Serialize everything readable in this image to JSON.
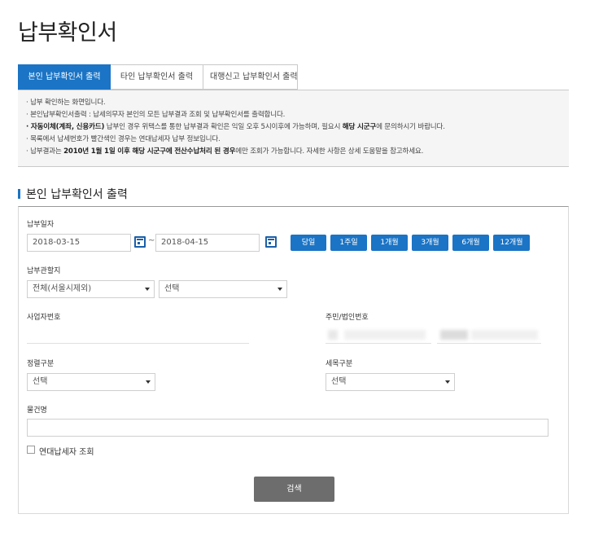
{
  "page": {
    "title": "납부확인서"
  },
  "tabs": [
    {
      "label": "본인 납부확인서 출력",
      "active": true
    },
    {
      "label": "타인 납부확인서 출력",
      "active": false
    },
    {
      "label": "대행신고 납부확인서 출력",
      "active": false
    }
  ],
  "info": {
    "line1": "· 납부 확인하는 화면입니다.",
    "line2": "· 본인납부확인서출력 : 납세의무자 본인의 모든 납부결과 조회 및 납부확인서를 출력합니다.",
    "line3_bold1": "· 자동이체(계좌, 신용카드)",
    "line3_mid": " 납부인 경우 위택스를 통한 납부결과 확인은 익일 오후 5시이후에 가능하며, 필요시 ",
    "line3_bold2": "해당 시군구",
    "line3_end": "에 문의하시기 바랍니다.",
    "line4": "· 목록에서 납세번호가 빨간색인 경우는 연대납세자 납부 정보입니다.",
    "line5_start": "· 납부결과는 ",
    "line5_bold": "2010년 1월 1일 이후 해당 시군구에 전산수납처리 된 경우",
    "line5_end": "에만 조회가 가능합니다. 자세한 사항은 상세 도움말을 참고하세요."
  },
  "section": {
    "title": "본인 납부확인서 출력"
  },
  "form": {
    "pay_date_label": "납부일자",
    "date_from": "2018-03-15",
    "date_to": "2018-04-15",
    "date_sep": "~",
    "period_buttons": [
      "당일",
      "1주일",
      "1개월",
      "3개월",
      "6개월",
      "12개월"
    ],
    "office_label": "납부관할지",
    "office_region": "전체(서울시제외)",
    "office_sub": "선택",
    "bizno_label": "사업자번호",
    "bizno_value": "",
    "resno_label": "주민/법인번호",
    "type_label": "정렬구분",
    "type_value": "선택",
    "tax_label": "세목구분",
    "tax_value": "선택",
    "item_label": "물건명",
    "item_value": "",
    "joint_label": "연대납세자 조회",
    "search_label": "검색"
  }
}
